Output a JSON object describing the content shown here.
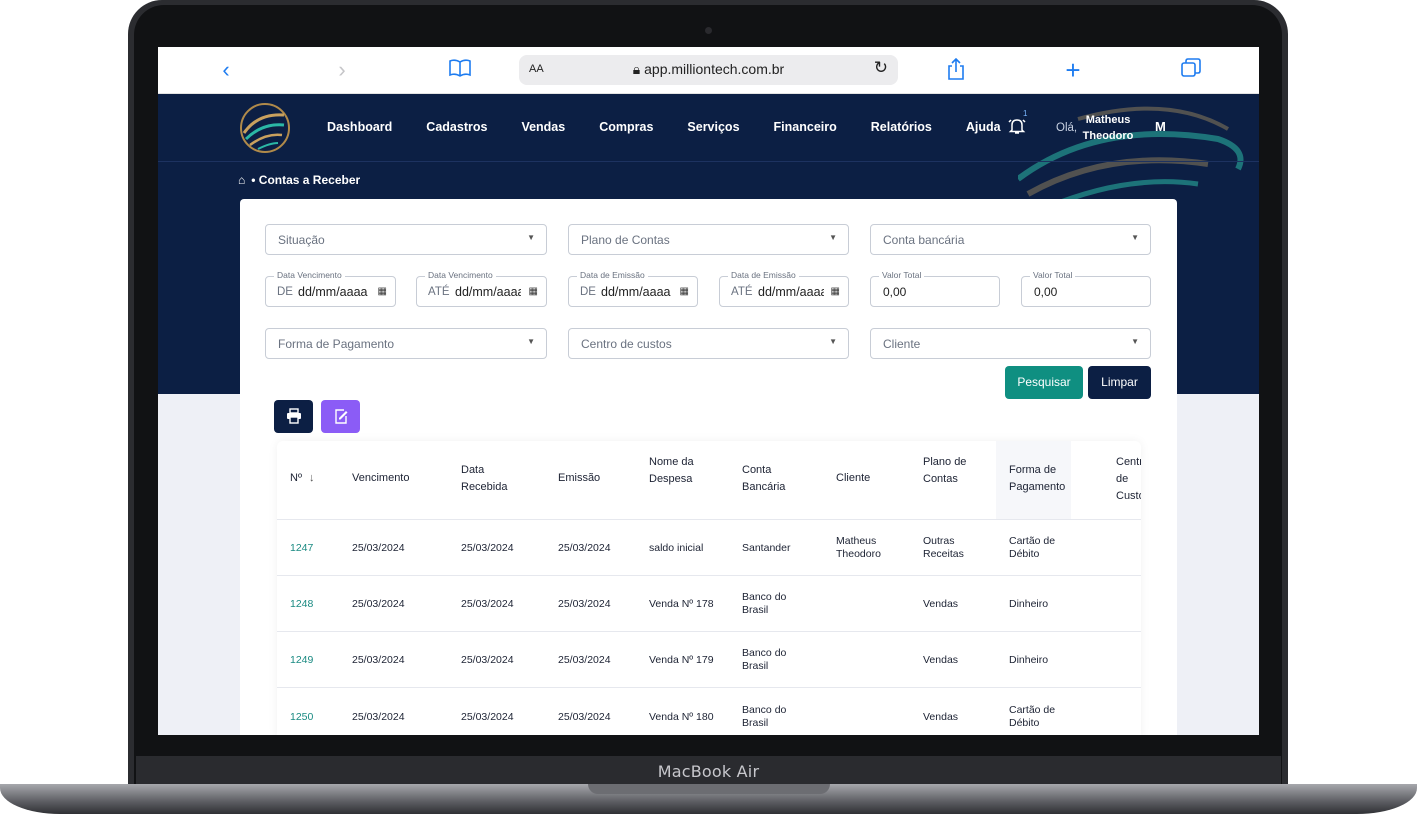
{
  "device": {
    "label": "MacBook Air"
  },
  "browser": {
    "text_size": "AA",
    "url": "app.milliontech.com.br"
  },
  "nav": {
    "items": [
      "Dashboard",
      "Cadastros",
      "Vendas",
      "Compras",
      "Serviços",
      "Financeiro",
      "Relatórios",
      "Ajuda"
    ],
    "notification_count": "1",
    "greeting": "Olá,",
    "user_name": "Matheus Theodoro",
    "user_initial": "M"
  },
  "breadcrumb": {
    "page": "Contas a Receber"
  },
  "filters": {
    "situacao": "Situação",
    "plano_contas": "Plano de Contas",
    "conta_bancaria": "Conta bancária",
    "venc_de": {
      "label": "Data Vencimento",
      "prefix": "DE",
      "value": "dd/mm/aaaa"
    },
    "venc_ate": {
      "label": "Data Vencimento",
      "prefix": "ATÉ",
      "value": "dd/mm/aaaa"
    },
    "emis_de": {
      "label": "Data de Emissão",
      "prefix": "DE",
      "value": "dd/mm/aaaa"
    },
    "emis_ate": {
      "label": "Data de Emissão",
      "prefix": "ATÉ",
      "value": "dd/mm/aaaa"
    },
    "valor_de": {
      "label": "Valor Total",
      "value": "0,00"
    },
    "valor_ate": {
      "label": "Valor Total",
      "value": "0,00"
    },
    "forma_pagamento": "Forma de Pagamento",
    "centro_custos": "Centro de custos",
    "cliente": "Cliente"
  },
  "actions": {
    "search": "Pesquisar",
    "clear": "Limpar"
  },
  "colors": {
    "navy": "#0c1f44",
    "teal": "#0f8f81",
    "purple": "#8b5cf6"
  },
  "table": {
    "headers": [
      "Nº",
      "Vencimento",
      "Data Recebida",
      "Emissão",
      "Nome da Despesa",
      "Conta Bancária",
      "Cliente",
      "Plano de Contas",
      "Forma de Pagamento",
      "Centro de Custos"
    ],
    "rows": [
      {
        "n": "1247",
        "venc": "25/03/2024",
        "receb": "25/03/2024",
        "emis": "25/03/2024",
        "nome": "saldo inicial",
        "conta": "Santander",
        "cliente": "Matheus Theodoro",
        "plano": "Outras Receitas",
        "forma": "Cartão de Débito"
      },
      {
        "n": "1248",
        "venc": "25/03/2024",
        "receb": "25/03/2024",
        "emis": "25/03/2024",
        "nome": "Venda Nº 178",
        "conta": "Banco do Brasil",
        "cliente": "",
        "plano": "Vendas",
        "forma": "Dinheiro"
      },
      {
        "n": "1249",
        "venc": "25/03/2024",
        "receb": "25/03/2024",
        "emis": "25/03/2024",
        "nome": "Venda Nº 179",
        "conta": "Banco do Brasil",
        "cliente": "",
        "plano": "Vendas",
        "forma": "Dinheiro"
      },
      {
        "n": "1250",
        "venc": "25/03/2024",
        "receb": "25/03/2024",
        "emis": "25/03/2024",
        "nome": "Venda Nº 180",
        "conta": "Banco do Brasil",
        "cliente": "",
        "plano": "Vendas",
        "forma": "Cartão de Débito"
      }
    ]
  }
}
